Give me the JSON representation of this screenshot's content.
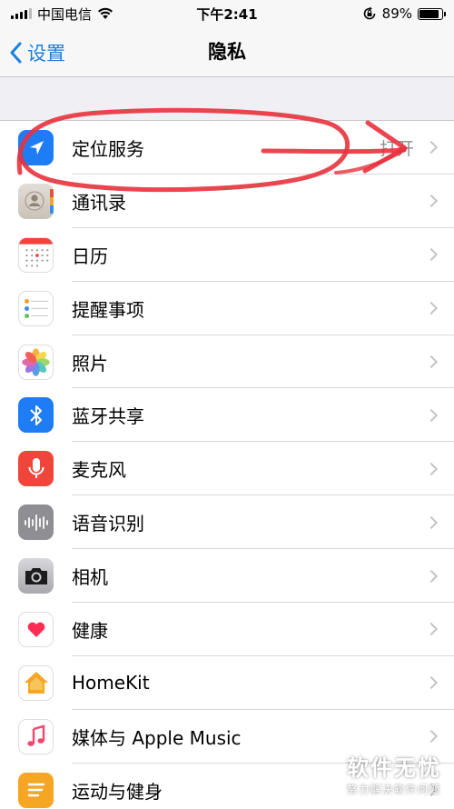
{
  "status_bar": {
    "carrier": "中国电信",
    "time": "下午2:41",
    "battery_percent": "89%",
    "battery_level": 0.89
  },
  "nav": {
    "back_label": "设置",
    "title": "隐私"
  },
  "rows": [
    {
      "label": "定位服务",
      "value": "打开",
      "icon": "location-arrow-icon"
    },
    {
      "label": "通讯录",
      "value": "",
      "icon": "contacts-icon"
    },
    {
      "label": "日历",
      "value": "",
      "icon": "calendar-icon"
    },
    {
      "label": "提醒事项",
      "value": "",
      "icon": "reminders-icon"
    },
    {
      "label": "照片",
      "value": "",
      "icon": "photos-icon"
    },
    {
      "label": "蓝牙共享",
      "value": "",
      "icon": "bluetooth-icon"
    },
    {
      "label": "麦克风",
      "value": "",
      "icon": "microphone-icon"
    },
    {
      "label": "语音识别",
      "value": "",
      "icon": "speech-recognition-icon"
    },
    {
      "label": "相机",
      "value": "",
      "icon": "camera-icon"
    },
    {
      "label": "健康",
      "value": "",
      "icon": "health-icon"
    },
    {
      "label": "HomeKit",
      "value": "",
      "icon": "homekit-icon"
    },
    {
      "label": "媒体与 Apple Music",
      "value": "",
      "icon": "music-icon"
    },
    {
      "label": "运动与健身",
      "value": "",
      "icon": "motion-fitness-icon"
    }
  ],
  "watermark": {
    "main": "软件无忧",
    "sub": "努力解决软件问题"
  },
  "colors": {
    "accent": "#1a7fe0",
    "annotation": "#e8323c"
  }
}
